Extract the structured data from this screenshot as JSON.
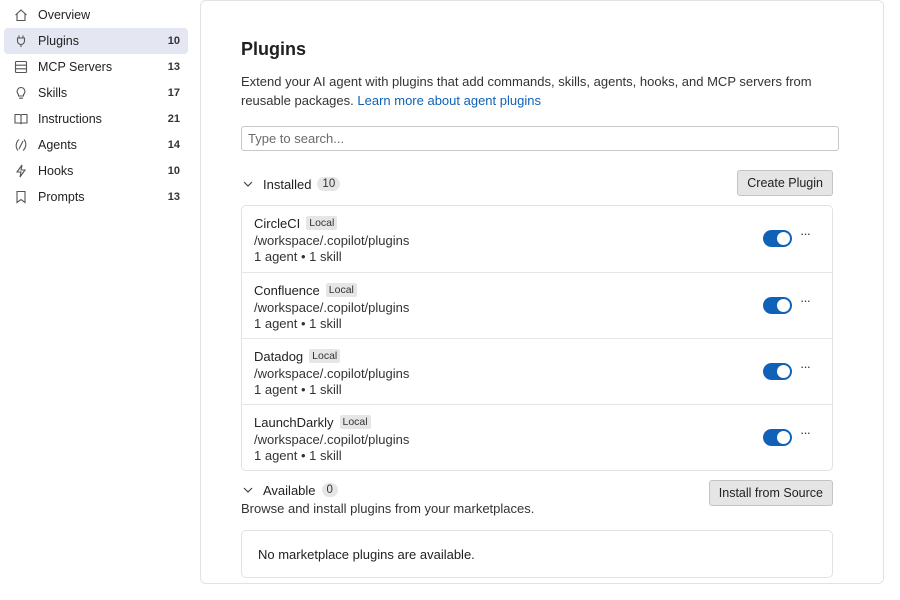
{
  "sidebar": {
    "items": [
      {
        "label": "Overview",
        "count": "",
        "icon": "home-icon"
      },
      {
        "label": "Plugins",
        "count": "10",
        "icon": "plug-icon"
      },
      {
        "label": "MCP Servers",
        "count": "13",
        "icon": "server-icon"
      },
      {
        "label": "Skills",
        "count": "17",
        "icon": "lightbulb-icon"
      },
      {
        "label": "Instructions",
        "count": "21",
        "icon": "book-icon"
      },
      {
        "label": "Agents",
        "count": "14",
        "icon": "agent-icon"
      },
      {
        "label": "Hooks",
        "count": "10",
        "icon": "bolt-icon"
      },
      {
        "label": "Prompts",
        "count": "13",
        "icon": "bookmark-icon"
      }
    ],
    "active": "Plugins"
  },
  "main": {
    "title": "Plugins",
    "description": "Extend your AI agent with plugins that add commands, skills, agents, hooks, and MCP servers from reusable packages.",
    "learn_more": "Learn more about agent plugins",
    "search_placeholder": "Type to search...",
    "installed": {
      "label": "Installed",
      "count": "10",
      "button": "Create Plugin",
      "items": [
        {
          "name": "CircleCI",
          "tag": "Local",
          "path": "/workspace/.copilot/plugins",
          "meta": "1 agent • 1 skill",
          "enabled": true
        },
        {
          "name": "Confluence",
          "tag": "Local",
          "path": "/workspace/.copilot/plugins",
          "meta": "1 agent • 1 skill",
          "enabled": true
        },
        {
          "name": "Datadog",
          "tag": "Local",
          "path": "/workspace/.copilot/plugins",
          "meta": "1 agent • 1 skill",
          "enabled": true
        },
        {
          "name": "LaunchDarkly",
          "tag": "Local",
          "path": "/workspace/.copilot/plugins",
          "meta": "1 agent • 1 skill",
          "enabled": true
        }
      ]
    },
    "available": {
      "label": "Available",
      "count": "0",
      "button": "Install from Source",
      "subtitle": "Browse and install plugins from your marketplaces.",
      "empty": "No marketplace plugins are available."
    }
  },
  "colors": {
    "accent": "#0f62b7",
    "active_nav_bg": "#e4e6f1"
  }
}
